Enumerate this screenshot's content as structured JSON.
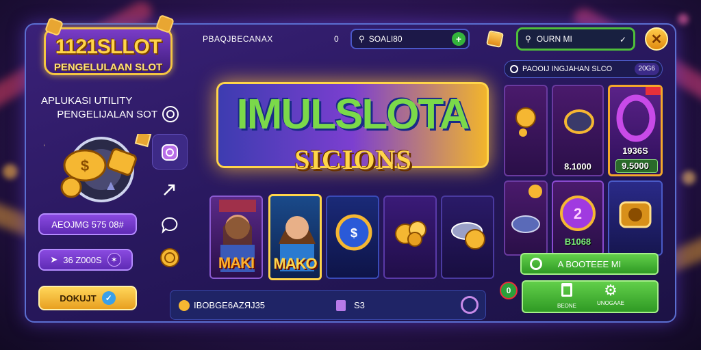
{
  "logo": {
    "title": "1121SLLOT",
    "subtitle": "PENGELULAAN SLOT"
  },
  "left_panel": {
    "title_line1": "APLUKASI UTILITY",
    "title_line2": "PENGELIJALAN SOT",
    "pill1_label": "AEOJMG 575 08#",
    "pill2_label": "36 Z000S",
    "button_label": "DOKUJT"
  },
  "top_bar": {
    "label": "PBAQJBECANAX",
    "count": "0",
    "search_value": "SOALI80",
    "search2_value": "OURN MI"
  },
  "hero": {
    "line1": "IMULSLOTA",
    "line2": "SICIONS"
  },
  "game_cards": [
    {
      "label": "MAKI"
    },
    {
      "label": "MAKO"
    },
    {
      "label": ""
    },
    {
      "label": ""
    },
    {
      "label": ""
    }
  ],
  "bottom_bar": {
    "left_text": "IBOBGE6AZЯJ35",
    "right_text": "S3"
  },
  "right_panel": {
    "header_label": "PAOOIJ INGJAHAN SLCO",
    "header_count": "20G6",
    "cards": [
      {
        "price": ""
      },
      {
        "price": "8.1000"
      },
      {
        "price": "1936S"
      },
      {
        "price": "9.5000"
      },
      {
        "price": ""
      },
      {
        "price": "B1068"
      },
      {
        "price": ""
      }
    ],
    "green_button_label": "A BOOTEEE MI",
    "action_left_label": "BEONE",
    "action_right_label": "UNOGAAE",
    "badge_count": "0"
  },
  "colors": {
    "frame_border": "#5b6fd1",
    "accent_gold": "#ffd54a",
    "accent_green": "#4fbf3a",
    "accent_purple": "#8a4ae0"
  }
}
